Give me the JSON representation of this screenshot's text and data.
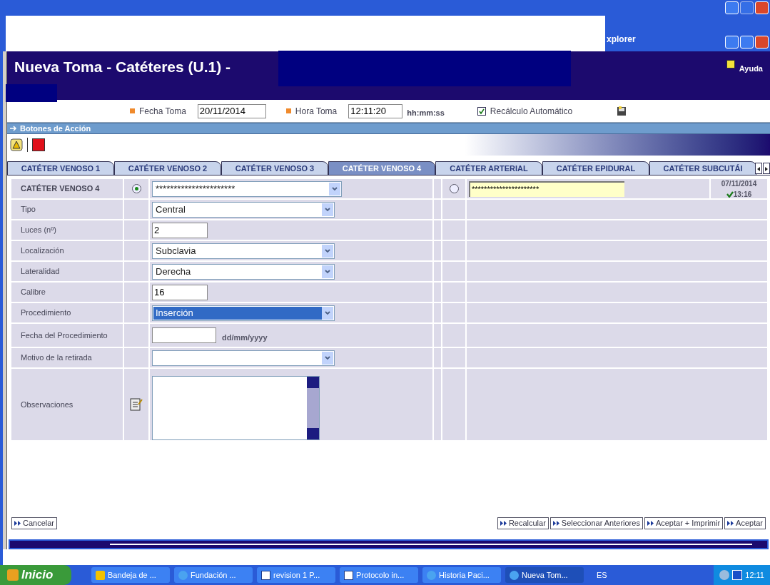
{
  "browser_title": "xplorer",
  "header": {
    "title": "Nueva Toma - Catéteres (U.1) -",
    "help": "Ayuda"
  },
  "toma": {
    "fecha_label": "Fecha Toma",
    "fecha": "20/11/2014",
    "hora_label": "Hora Toma",
    "hora": "12:11:20",
    "hora_hint": "hh:mm:ss",
    "recalculo_label": "Recálculo Automático",
    "recalculo_checked": true
  },
  "section": "Botones de Acción",
  "tabs": [
    {
      "label": "CATÉTER VENOSO 1",
      "selected": false
    },
    {
      "label": "CATÉTER VENOSO 2",
      "selected": false
    },
    {
      "label": "CATÉTER VENOSO 3",
      "selected": false
    },
    {
      "label": "CATÉTER VENOSO 4",
      "selected": true
    },
    {
      "label": "CATÉTER ARTERIAL",
      "selected": false
    },
    {
      "label": "CATÉTER EPIDURAL",
      "selected": false
    },
    {
      "label": "CATÉTER SUBCUTÁI",
      "selected": false
    }
  ],
  "form": {
    "current_selected": true,
    "previous_selected": false,
    "previous_value": "**********************",
    "previous_date": "07/11/2014",
    "previous_time": "13:16",
    "rows": [
      {
        "kind": "select",
        "label": "CATÉTER VENOSO 4",
        "value": "**********************",
        "highlighted": false
      },
      {
        "kind": "select",
        "label": "Tipo",
        "value": "Central",
        "highlighted": false
      },
      {
        "kind": "text",
        "label": "Luces (nº)",
        "value": "2"
      },
      {
        "kind": "select",
        "label": "Localización",
        "value": "Subclavia",
        "highlighted": false
      },
      {
        "kind": "select",
        "label": "Lateralidad",
        "value": "Derecha",
        "highlighted": false
      },
      {
        "kind": "text",
        "label": "Calibre",
        "value": "16"
      },
      {
        "kind": "select",
        "label": "Procedimiento",
        "value": "Inserción",
        "highlighted": true
      },
      {
        "kind": "date",
        "label": "Fecha del Procedimiento",
        "hint": "dd/mm/yyyy"
      },
      {
        "kind": "select",
        "label": "Motivo de la retirada",
        "highlighted": false
      },
      {
        "kind": "textarea",
        "label": "Observaciones"
      }
    ]
  },
  "footer": {
    "left": [
      "Cancelar"
    ],
    "right": [
      "Recalcular",
      "Seleccionar Anteriores",
      "Aceptar + Imprimir",
      "Aceptar"
    ]
  },
  "taskbar": {
    "start": "Inicio",
    "tasks": [
      {
        "label": "Bandeja de ...",
        "kind": "app",
        "selected": false
      },
      {
        "label": "Fundación ...",
        "kind": "browser",
        "selected": false
      },
      {
        "label": "revision 1 P...",
        "kind": "doc",
        "selected": false
      },
      {
        "label": "Protocolo in...",
        "kind": "doc",
        "selected": false
      },
      {
        "label": "Historia Paci...",
        "kind": "browser",
        "selected": false
      },
      {
        "label": "Nueva Tom...",
        "kind": "browser",
        "selected": true
      }
    ],
    "language": "ES",
    "clock": "12:11"
  }
}
